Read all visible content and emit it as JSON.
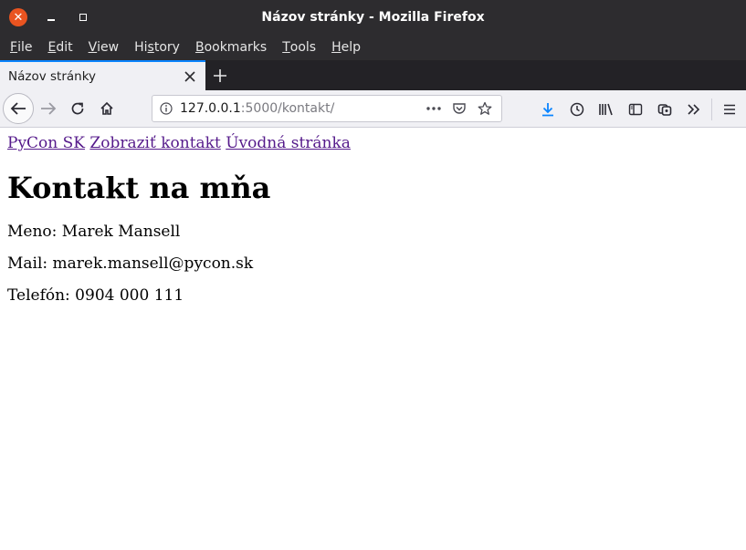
{
  "window": {
    "title": "Názov stránky - Mozilla Firefox",
    "close_icon": "close-icon",
    "minimize_icon": "minimize-icon",
    "maximize_icon": "maximize-icon"
  },
  "menubar": {
    "items": [
      {
        "acc": "F",
        "rest": "ile"
      },
      {
        "acc": "E",
        "rest": "dit"
      },
      {
        "acc": "V",
        "rest": "iew"
      },
      {
        "pre": "Hi",
        "acc": "s",
        "rest": "tory"
      },
      {
        "acc": "B",
        "rest": "ookmarks"
      },
      {
        "acc": "T",
        "rest": "ools"
      },
      {
        "acc": "H",
        "rest": "elp"
      }
    ]
  },
  "tabs": {
    "active_label": "Názov stránky",
    "new_tab_icon": "plus-icon"
  },
  "navbar": {
    "url_host": "127.0.0.1",
    "url_rest": ":5000/kontakt/",
    "accent": "#0a84ff"
  },
  "page": {
    "links": [
      "PyCon SK",
      "Zobraziť kontakt",
      "Úvodná stránka"
    ],
    "heading": "Kontakt na mňa",
    "lines": [
      "Meno: Marek Mansell",
      "Mail: marek.mansell@pycon.sk",
      "Telefón: 0904 000 111"
    ],
    "link_color": "#551a8b"
  }
}
